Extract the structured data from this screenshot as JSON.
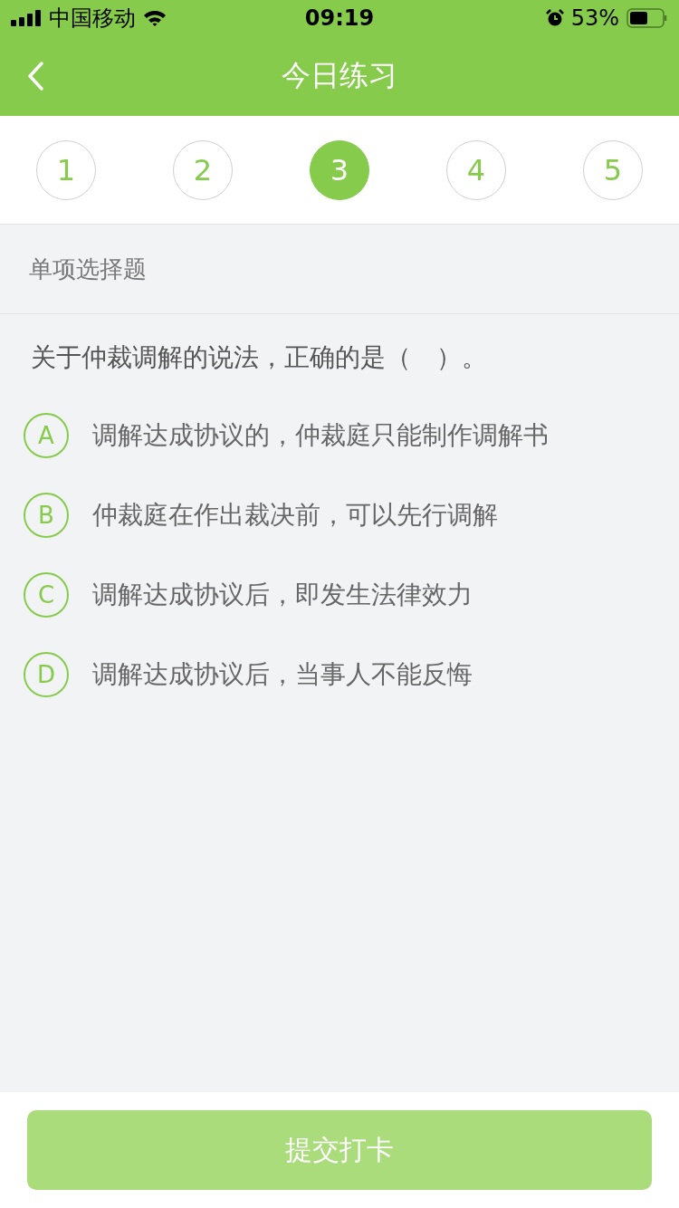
{
  "status_bar": {
    "carrier": "中国移动",
    "time": "09:19",
    "battery": "53%"
  },
  "nav": {
    "title": "今日练习"
  },
  "steps": [
    {
      "label": "1",
      "selected": false
    },
    {
      "label": "2",
      "selected": false
    },
    {
      "label": "3",
      "selected": true
    },
    {
      "label": "4",
      "selected": false
    },
    {
      "label": "5",
      "selected": false
    }
  ],
  "question_type": "单项选择题",
  "question": "关于仲裁调解的说法，正确的是（　）。",
  "options": [
    {
      "letter": "A",
      "text": "调解达成协议的，仲裁庭只能制作调解书",
      "selected": false
    },
    {
      "letter": "B",
      "text": "仲裁庭在作出裁决前，可以先行调解",
      "selected": false
    },
    {
      "letter": "C",
      "text": "调解达成协议后，即发生法律效力",
      "selected": false
    },
    {
      "letter": "D",
      "text": "调解达成协议后，当事人不能反悔",
      "selected": false
    }
  ],
  "submit": {
    "label": "提交打卡",
    "disabled": true
  }
}
